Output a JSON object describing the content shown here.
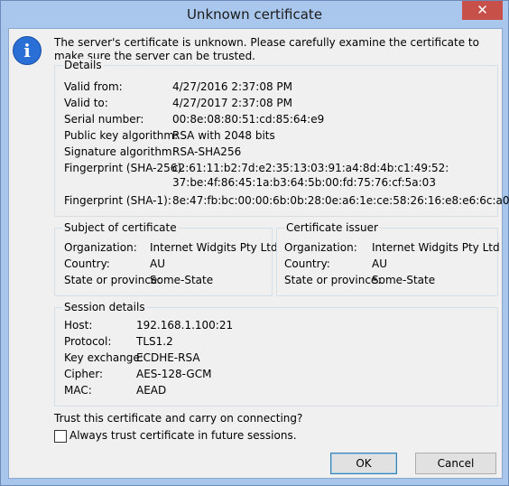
{
  "window": {
    "title": "Unknown certificate",
    "close_glyph": "✕"
  },
  "message": "The server's certificate is unknown. Please carefully examine the certificate to make sure the server can be trusted.",
  "details": {
    "title": "Details",
    "rows": [
      {
        "label": "Valid from:",
        "value": "4/27/2016 2:37:08 PM"
      },
      {
        "label": "Valid to:",
        "value": "4/27/2017 2:37:08 PM"
      },
      {
        "label": "Serial number:",
        "value": "00:8e:08:80:51:cd:85:64:e9"
      },
      {
        "label": "Public key algorithm:",
        "value": "RSA with 2048 bits"
      },
      {
        "label": "Signature algorithm:",
        "value": "RSA-SHA256"
      },
      {
        "label": "Fingerprint (SHA-256):",
        "value": "c2:61:11:b2:7d:e2:35:13:03:91:a4:8d:4b:c1:49:52:",
        "value2": "37:be:4f:86:45:1a:b3:64:5b:00:fd:75:76:cf:5a:03"
      },
      {
        "label": "Fingerprint (SHA-1):",
        "value": "8e:47:fb:bc:00:00:6b:0b:28:0e:a6:1e:ce:58:26:16:e8:e6:6c:a0"
      }
    ]
  },
  "subject": {
    "title": "Subject of certificate",
    "rows": [
      {
        "label": "Organization:",
        "value": "Internet Widgits Pty Ltd"
      },
      {
        "label": "Country:",
        "value": "AU"
      },
      {
        "label": "State or province:",
        "value": "Some-State"
      }
    ]
  },
  "issuer": {
    "title": "Certificate issuer",
    "rows": [
      {
        "label": "Organization:",
        "value": "Internet Widgits Pty Ltd"
      },
      {
        "label": "Country:",
        "value": "AU"
      },
      {
        "label": "State or province:",
        "value": "Some-State"
      }
    ]
  },
  "session": {
    "title": "Session details",
    "rows": [
      {
        "label": "Host:",
        "value": "192.168.1.100:21"
      },
      {
        "label": "Protocol:",
        "value": "TLS1.2"
      },
      {
        "label": "Key exchange:",
        "value": "ECDHE-RSA"
      },
      {
        "label": "Cipher:",
        "value": "AES-128-GCM"
      },
      {
        "label": "MAC:",
        "value": "AEAD"
      }
    ]
  },
  "trust_question": "Trust this certificate and carry on connecting?",
  "always_trust_label": "Always trust certificate in future sessions.",
  "always_trust_checked": false,
  "buttons": {
    "ok": "OK",
    "cancel": "Cancel"
  },
  "icons": {
    "info": "info-icon"
  }
}
